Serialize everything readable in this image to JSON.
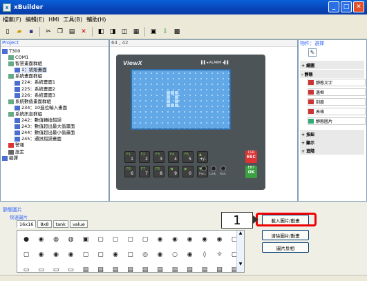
{
  "window": {
    "title": "xBuilder",
    "controls": [
      "_",
      "□",
      "✕"
    ]
  },
  "menu": [
    "檔案(F)",
    "編輯(E)",
    "HMI",
    "工具(B)",
    "輔助(H)"
  ],
  "toolbar_icons": [
    "new-icon",
    "open-icon",
    "save-icon",
    "cut-icon",
    "copy-icon",
    "paste-icon",
    "delete-icon",
    "undo-icon",
    "redo-icon",
    "zoom-icon",
    "grid-icon",
    "screen-icon",
    "image-icon"
  ],
  "project": {
    "header": "Project",
    "tree": [
      {
        "label": "T300",
        "indent": 0,
        "icon": "folder-icon",
        "color": "#4a6fd0"
      },
      {
        "label": "COM1",
        "indent": 1,
        "icon": "port-icon",
        "color": "#6a8"
      },
      {
        "label": "智慧畫面群組",
        "indent": 1,
        "icon": "group-icon",
        "color": "#6a8"
      },
      {
        "label": "1：初始畫面",
        "indent": 2,
        "icon": "screen-icon",
        "color": "#4a6fd0",
        "selected": true
      },
      {
        "label": "系統畫面群組",
        "indent": 1,
        "icon": "group-icon",
        "color": "#6a8"
      },
      {
        "label": "224：系統畫面1",
        "indent": 2,
        "icon": "screen-icon",
        "color": "#4a6fd0"
      },
      {
        "label": "225：系統畫面2",
        "indent": 2,
        "icon": "screen-icon",
        "color": "#4a6fd0"
      },
      {
        "label": "226：系統畫面3",
        "indent": 2,
        "icon": "screen-icon",
        "color": "#4a6fd0"
      },
      {
        "label": "系統數值畫面群組",
        "indent": 1,
        "icon": "group-icon",
        "color": "#6a8"
      },
      {
        "label": "234：10進位輸入畫面",
        "indent": 2,
        "icon": "screen-icon",
        "color": "#4a6fd0"
      },
      {
        "label": "系統訊息群組",
        "indent": 1,
        "icon": "group-icon",
        "color": "#6a8"
      },
      {
        "label": "242：數值轉換錯誤",
        "indent": 2,
        "icon": "screen-icon",
        "color": "#4a6fd0"
      },
      {
        "label": "243：數值超出最大值畫面",
        "indent": 2,
        "icon": "screen-icon",
        "color": "#4a6fd0"
      },
      {
        "label": "244：數值超出最小值畫面",
        "indent": 2,
        "icon": "screen-icon",
        "color": "#4a6fd0"
      },
      {
        "label": "245：通訊錯誤畫面",
        "indent": 2,
        "icon": "screen-icon",
        "color": "#4a6fd0"
      },
      {
        "label": "警報",
        "indent": 1,
        "icon": "alarm-icon",
        "color": "#d33"
      },
      {
        "label": "設定",
        "indent": 1,
        "icon": "settings-icon",
        "color": "#666"
      },
      {
        "label": "編譯",
        "indent": 0,
        "icon": "compile-icon",
        "color": "#4a6fd0"
      }
    ]
  },
  "canvas": {
    "coords": "64 , 42",
    "logo": "ViewX",
    "alarm": "▌▌◂ ALARM ◂▌▌",
    "fkeys_row1": [
      {
        "t": "F1",
        "n": "1"
      },
      {
        "t": "F2",
        "n": "2"
      },
      {
        "t": "F3",
        "n": "3"
      },
      {
        "t": "F4",
        "n": "4"
      },
      {
        "t": "F5",
        "n": "5"
      },
      {
        "t": "▲",
        "n": "+/-"
      }
    ],
    "fkeys_row2": [
      {
        "t": "F6",
        "n": "6"
      },
      {
        "t": "F7",
        "n": "7"
      },
      {
        "t": "F8",
        "n": "8"
      },
      {
        "t": "◀",
        "n": "9"
      },
      {
        "t": "▶",
        "n": "0"
      },
      {
        "t": "▼",
        "n": "."
      }
    ],
    "esc": {
      "top": "CLR",
      "label": "ESC"
    },
    "ok": {
      "top": "ENT",
      "label": "OK"
    },
    "knobs": [
      "Pwr",
      "Link",
      "Run"
    ]
  },
  "objects": {
    "header": "物件：選擇",
    "pointer": "pointer-icon",
    "sections": [
      "+ 繪圖",
      "- 靜態",
      "+ 按鈕",
      "+ 顯示",
      "+ 進階"
    ],
    "static_items": [
      {
        "label": "靜態文字",
        "icon": "text-icon",
        "color": "#c33"
      },
      {
        "label": "邊框",
        "icon": "frame-icon",
        "color": "#c33"
      },
      {
        "label": "刻度",
        "icon": "scale-icon",
        "color": "#c33"
      },
      {
        "label": "表格",
        "icon": "table-icon",
        "color": "#c33"
      },
      {
        "label": "靜態圖片",
        "icon": "image-icon",
        "color": "#3a7"
      }
    ]
  },
  "bottom": {
    "header": "靜態圖片",
    "quick_label": "快速圖片",
    "tabs": [
      "16x16",
      "8x8",
      "tank",
      "value"
    ],
    "active_tab": 0,
    "icons_row1": [
      "●",
      "◉",
      "◍",
      "◍",
      "▣",
      "▢",
      "▢",
      "▢",
      "▢",
      "◉",
      "◉",
      "◉",
      "◉",
      "◉",
      "▢",
      "◉"
    ],
    "icons_row2": [
      "▢",
      "◉",
      "◉",
      "◉",
      "▢",
      "▢",
      "◉",
      "▢",
      "◎",
      "◉",
      "○",
      "◉",
      "◊",
      "☼",
      "▢"
    ],
    "icons_row3": [
      "▭",
      "▭",
      "▭",
      "▭",
      "▤",
      "▤",
      "▤",
      "▤",
      "▤",
      "▤",
      "▤",
      "▤",
      "▤",
      "▤",
      "▤"
    ],
    "buttons": [
      "載入圖片/動畫",
      "清除圖片/動畫",
      "圖片反相"
    ],
    "callout": "1"
  },
  "accent_colors": {
    "title": "#0845b8",
    "highlight": "#e00000",
    "screen": "#62a7e6"
  }
}
